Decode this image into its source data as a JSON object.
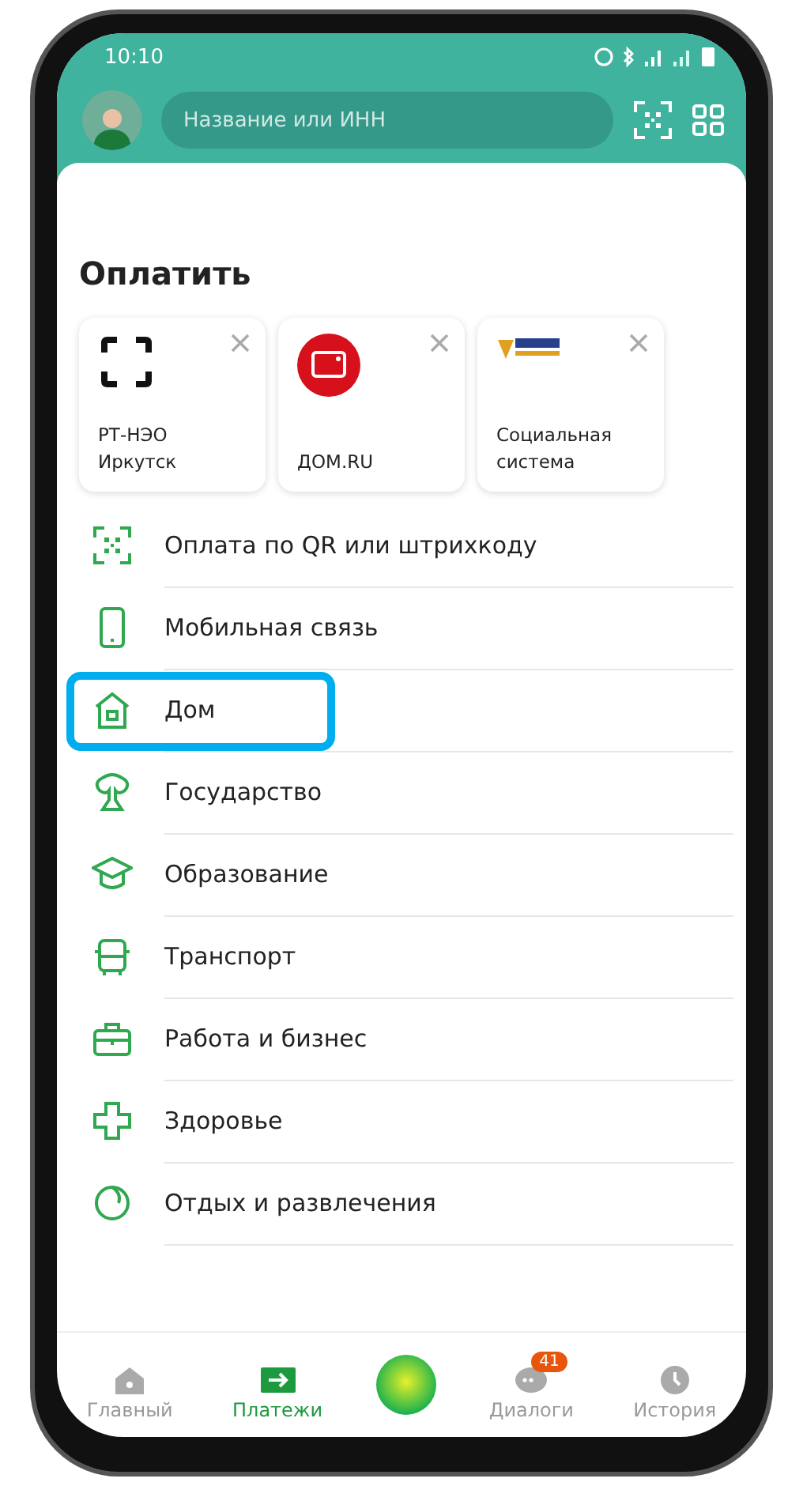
{
  "status_bar": {
    "time": "10:10"
  },
  "header": {
    "search": {
      "placeholder": "Название или ИНН"
    }
  },
  "section_title": "Оплатить",
  "favorites": [
    {
      "kind": "brackets",
      "label": "РТ-НЭО Иркутск"
    },
    {
      "kind": "red-circle",
      "label": "ДОМ.RU"
    },
    {
      "kind": "emblem",
      "label": "Социальная система"
    }
  ],
  "categories": [
    {
      "label": "Оплата по QR или штрихкоду",
      "highlighted": false
    },
    {
      "label": "Мобильная связь",
      "highlighted": false
    },
    {
      "label": "Дом",
      "highlighted": true
    },
    {
      "label": "Государство",
      "highlighted": false
    },
    {
      "label": "Образование",
      "highlighted": false
    },
    {
      "label": "Транспорт",
      "highlighted": false
    },
    {
      "label": "Работа и бизнес",
      "highlighted": false
    },
    {
      "label": "Здоровье",
      "highlighted": false
    },
    {
      "label": "Отдых и развлечения",
      "highlighted": false
    }
  ],
  "tab_bar": [
    {
      "kind": "tab",
      "label": "Главный",
      "selected": false
    },
    {
      "kind": "tab",
      "label": "Платежи",
      "selected": true
    },
    {
      "kind": "assistant"
    },
    {
      "kind": "tab",
      "label": "Диалоги",
      "selected": false,
      "badge": "41"
    },
    {
      "kind": "tab",
      "label": "История",
      "selected": false
    }
  ]
}
